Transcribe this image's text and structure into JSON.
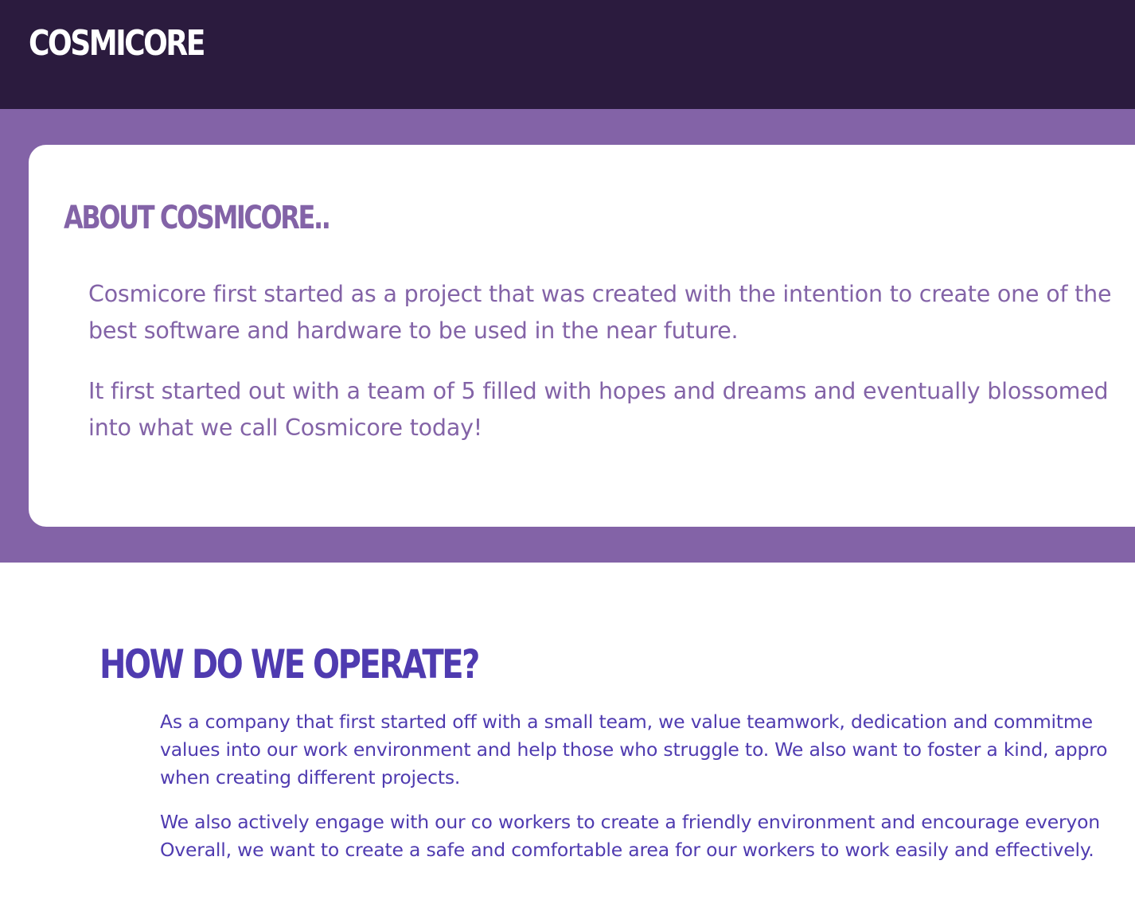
{
  "header": {
    "brand": "COSMICORE"
  },
  "about": {
    "heading": "ABOUT COSMICORE..",
    "paragraph_1": "Cosmicore first started as a project that was created with the intention to create one of the best software and hardware to be used in the near future.",
    "paragraph_2": "It first started out with a team of 5 filled with hopes and dreams and eventually blossomed into what we call Cosmicore today!"
  },
  "operate": {
    "heading": "HOW DO WE OPERATE?",
    "paragraph_1_lines": [
      "As a company that first started off with a small team, we value teamwork, dedication and commitme",
      "values into our work environment and help those who struggle to. We also want to foster a kind, appro",
      "when creating different projects."
    ],
    "paragraph_2_lines": [
      "We also actively engage with our co workers to create a friendly environment and encourage everyon",
      "Overall, we want to create a safe and comfortable area for our workers to work easily and effectively."
    ]
  },
  "colors": {
    "header_bg": "#2b1b3e",
    "about_band_bg": "#8363a7",
    "about_text": "#8363a7",
    "operate_text": "#4f3bb0"
  }
}
